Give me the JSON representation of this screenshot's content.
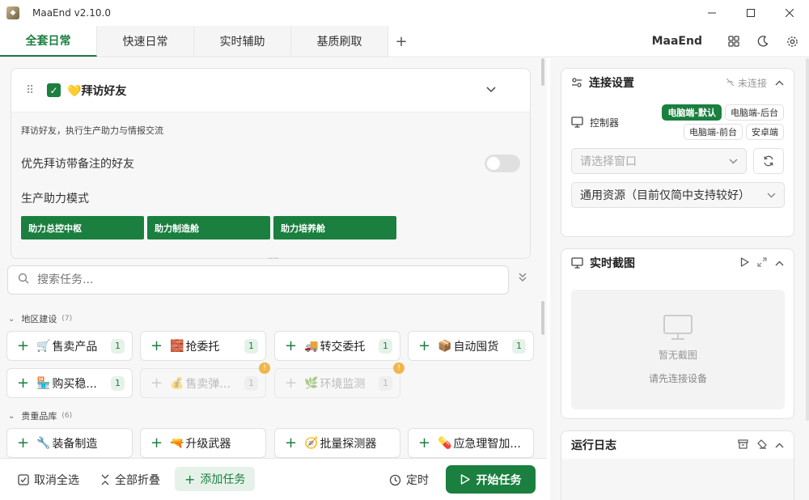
{
  "window": {
    "title": "MaaEnd v2.10.0",
    "controls": [
      "minimize-icon",
      "maximize-icon",
      "close-icon"
    ]
  },
  "tabs": [
    {
      "label": "全套日常",
      "active": true
    },
    {
      "label": "快速日常",
      "active": false
    },
    {
      "label": "实时辅助",
      "active": false
    },
    {
      "label": "基质刷取",
      "active": false
    }
  ],
  "toolbar": {
    "brand": "MaaEnd",
    "icons": [
      "grid-icon",
      "moon-icon",
      "gear-icon"
    ]
  },
  "task_card": {
    "drag_handle": "⠿",
    "checked": true,
    "emoji": "💛",
    "title": "拜访好友",
    "description": "拜访好友，执行生产助力与情报交流",
    "option_label": "优先拜访带备注的好友",
    "option_enabled": false,
    "mode_label": "生产助力模式",
    "mode_buttons": [
      "助力总控中枢",
      "助力制造舱",
      "助力培养舱"
    ]
  },
  "search": {
    "placeholder": "搜索任务..."
  },
  "groups": [
    {
      "name": "地区建设",
      "count": "(7)",
      "tasks": [
        {
          "emoji": "🛒",
          "name": "售卖产品",
          "count": "1",
          "disabled": false
        },
        {
          "emoji": "🧱",
          "name": "抢委托",
          "count": "1",
          "disabled": false
        },
        {
          "emoji": "🚚",
          "name": "转交委托",
          "count": "1",
          "disabled": false
        },
        {
          "emoji": "📦",
          "name": "自动囤货",
          "count": "1",
          "disabled": false
        },
        {
          "emoji": "🏪",
          "name": "购买稳...",
          "count": "1",
          "disabled": false
        },
        {
          "emoji": "💰",
          "name": "售卖弹...",
          "count": "1",
          "disabled": true
        },
        {
          "emoji": "🌿",
          "name": "环境监测",
          "count": "1",
          "disabled": true
        }
      ]
    },
    {
      "name": "贵重品库",
      "count": "(6)",
      "tasks": [
        {
          "emoji": "🔧",
          "name": "装备制造"
        },
        {
          "emoji": "🔫",
          "name": "升级武器"
        },
        {
          "emoji": "🧭",
          "name": "批量探测器"
        },
        {
          "emoji": "💊",
          "name": "应急理智加..."
        }
      ]
    }
  ],
  "bottom_bar": {
    "deselect_all": "取消全选",
    "collapse_all": "全部折叠",
    "add_task": "添加任务",
    "timer": "定时",
    "start": "开始任务"
  },
  "connection": {
    "title": "连接设置",
    "status": "未连接",
    "controller_label": "控制器",
    "controllers": [
      {
        "label": "电脑端-默认",
        "active": true
      },
      {
        "label": "电脑端-后台",
        "active": false
      },
      {
        "label": "电脑端-前台",
        "active": false
      },
      {
        "label": "安卓端",
        "active": false
      }
    ],
    "window_placeholder": "请选择窗口",
    "resource": "通用资源（目前仅简中支持较好）"
  },
  "screenshot": {
    "title": "实时截图",
    "empty_line1": "暂无截图",
    "empty_line2": "请先连接设备"
  },
  "log": {
    "title": "运行日志"
  },
  "colors": {
    "accent": "#1a7f3f",
    "accent_light": "#e6f2e9",
    "warning": "#f0b64a"
  }
}
